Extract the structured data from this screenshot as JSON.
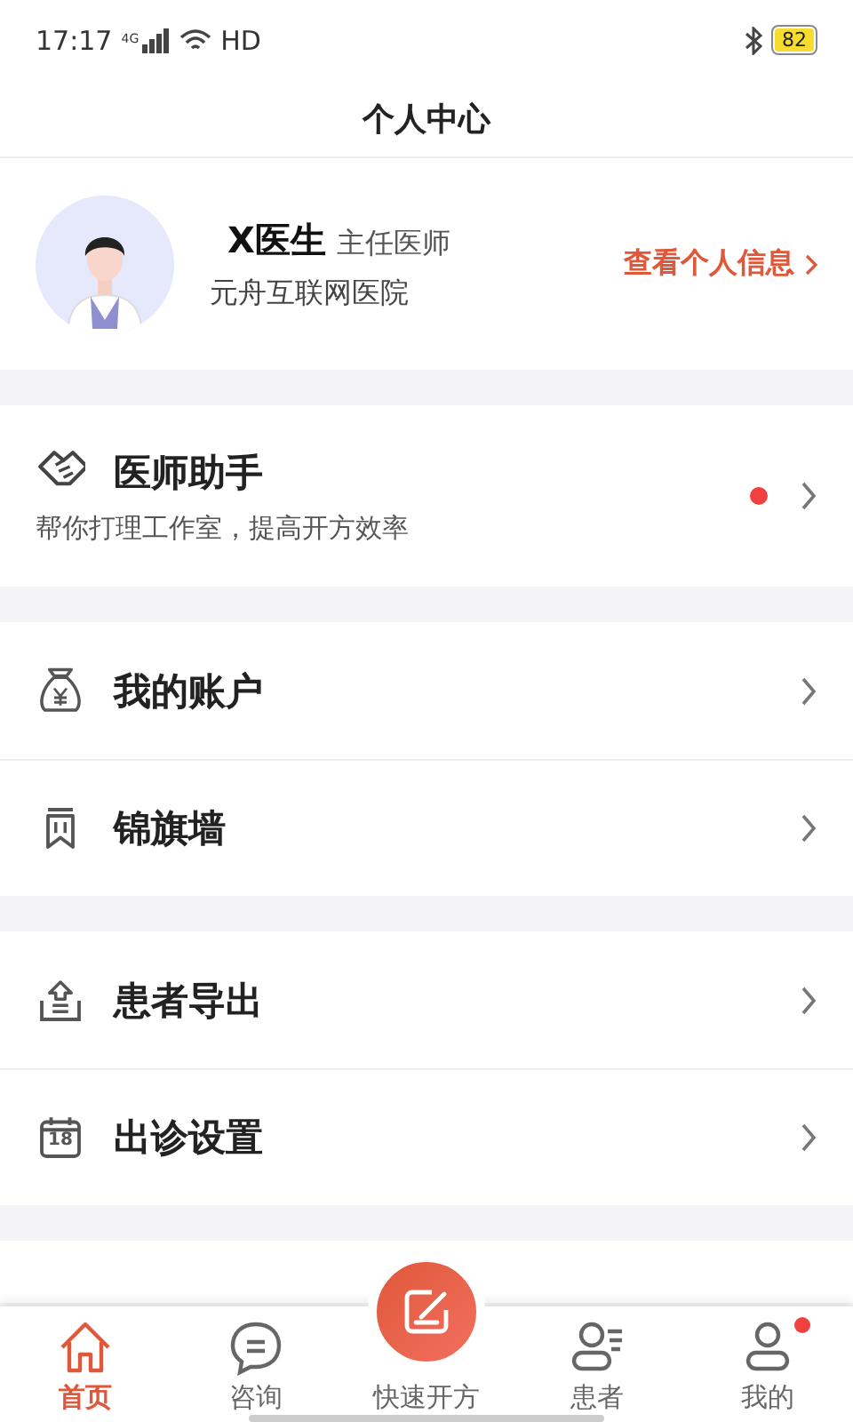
{
  "status_bar": {
    "time": "17:17",
    "network": "4G",
    "hd": "HD",
    "battery": "82"
  },
  "header": {
    "title": "个人中心"
  },
  "profile": {
    "name": "X医生",
    "title": "主任医师",
    "hospital": "元舟互联网医院",
    "link": "查看个人信息"
  },
  "sections": [
    [
      {
        "kind": "assistant",
        "label": "医师助手",
        "subtitle": "帮你打理工作室，提高开方效率",
        "unread": true
      }
    ],
    [
      {
        "kind": "plain",
        "label": "我的账户",
        "unread": false
      },
      {
        "kind": "plain",
        "label": "锦旗墙",
        "unread": false
      }
    ],
    [
      {
        "kind": "plain",
        "label": "患者导出",
        "unread": false
      },
      {
        "kind": "plain",
        "icon_label": "18",
        "label": "出诊设置",
        "unread": false
      }
    ]
  ],
  "tabs": [
    {
      "kind": "tab",
      "label": "首页",
      "selected": true,
      "badge": false
    },
    {
      "kind": "tab",
      "label": "咨询",
      "selected": false,
      "badge": false
    },
    {
      "kind": "fab",
      "label": "快速开方",
      "selected": false,
      "badge": false
    },
    {
      "kind": "tab",
      "label": "患者",
      "selected": false,
      "badge": false
    },
    {
      "kind": "tab",
      "label": "我的",
      "selected": false,
      "badge": true
    }
  ]
}
